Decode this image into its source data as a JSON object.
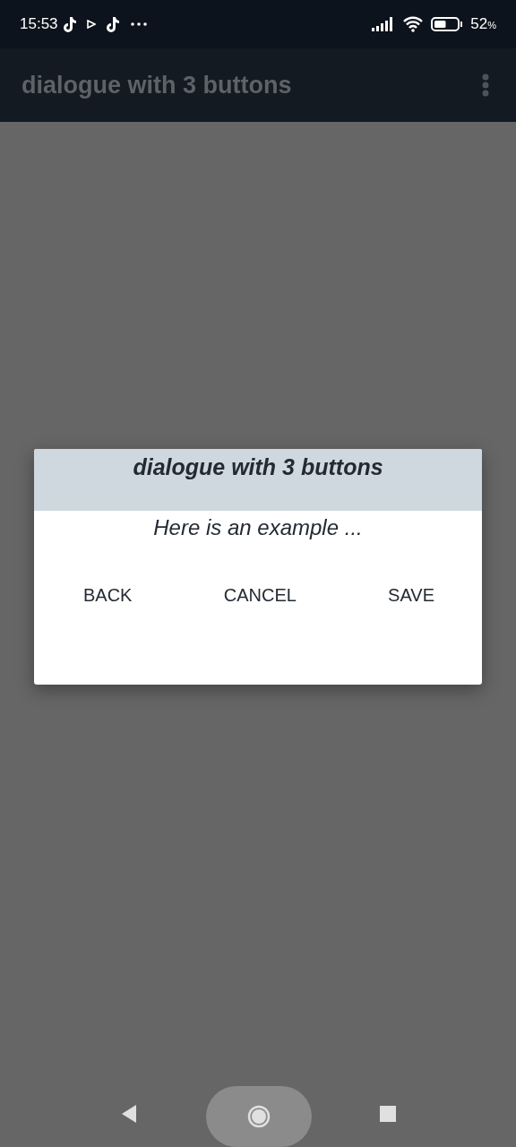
{
  "status_bar": {
    "time": "15:53",
    "battery": "52",
    "battery_unit": "%"
  },
  "app_bar": {
    "title": "dialogue with 3 buttons"
  },
  "dialog": {
    "title": "dialogue with 3 buttons",
    "message": "Here is an example ...",
    "buttons": [
      "BACK",
      "CANCEL",
      "SAVE"
    ]
  }
}
